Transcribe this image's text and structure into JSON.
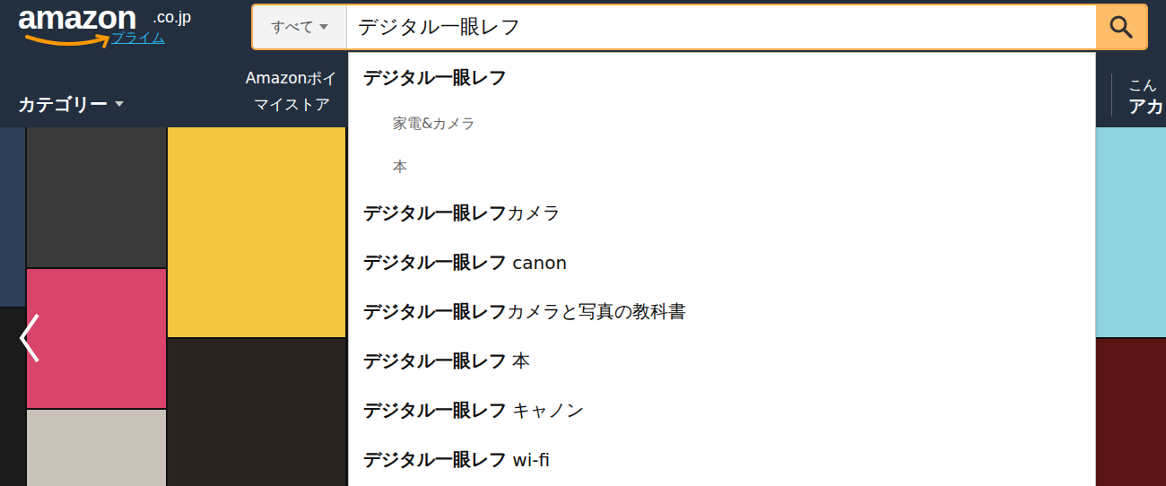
{
  "header": {
    "logo": {
      "wordmark": "amazon",
      "domain": ".co.jp",
      "prime": "プライム"
    },
    "search": {
      "category": "すべて",
      "query": "デジタル一眼レフ"
    },
    "nav": {
      "categories": "カテゴリー",
      "links": [
        "Amazonポイ",
        "マイストア"
      ]
    },
    "account": {
      "greeting": "こん",
      "label": "アカ"
    }
  },
  "suggestions": [
    {
      "kind": "query",
      "match": "デジタル一眼レフ",
      "rest": "",
      "selected": false
    },
    {
      "kind": "department",
      "text": "家電&カメラ",
      "selected": false
    },
    {
      "kind": "department",
      "text": "本",
      "selected": false
    },
    {
      "kind": "query",
      "match": "デジタル一眼レフ",
      "rest": "カメラ",
      "selected": false
    },
    {
      "kind": "query",
      "match": "デジタル一眼レフ",
      "rest": " canon",
      "selected": false
    },
    {
      "kind": "query",
      "match": "デジタル一眼レフ",
      "rest": "カメラと写真の教科書",
      "selected": false
    },
    {
      "kind": "query",
      "match": "デジタル一眼レフ",
      "rest": " 本",
      "selected": false
    },
    {
      "kind": "query",
      "match": "デジタル一眼レフ",
      "rest": " キャノン",
      "selected": false
    },
    {
      "kind": "query",
      "match": "デジタル一眼レフ",
      "rest": " wi-fi",
      "selected": false
    }
  ],
  "carousel": {
    "covers": [
      {
        "color": "#2c3e58"
      },
      {
        "color": "#1b1b1b"
      },
      {
        "color": "#3a3a3a"
      },
      {
        "color": "#d9446a"
      },
      {
        "color": "#c9c2b8"
      },
      {
        "color": "#f4c542"
      },
      {
        "color": "#2a2420"
      },
      {
        "color": "#8fd3e0"
      },
      {
        "color": "#5a1414"
      }
    ]
  }
}
